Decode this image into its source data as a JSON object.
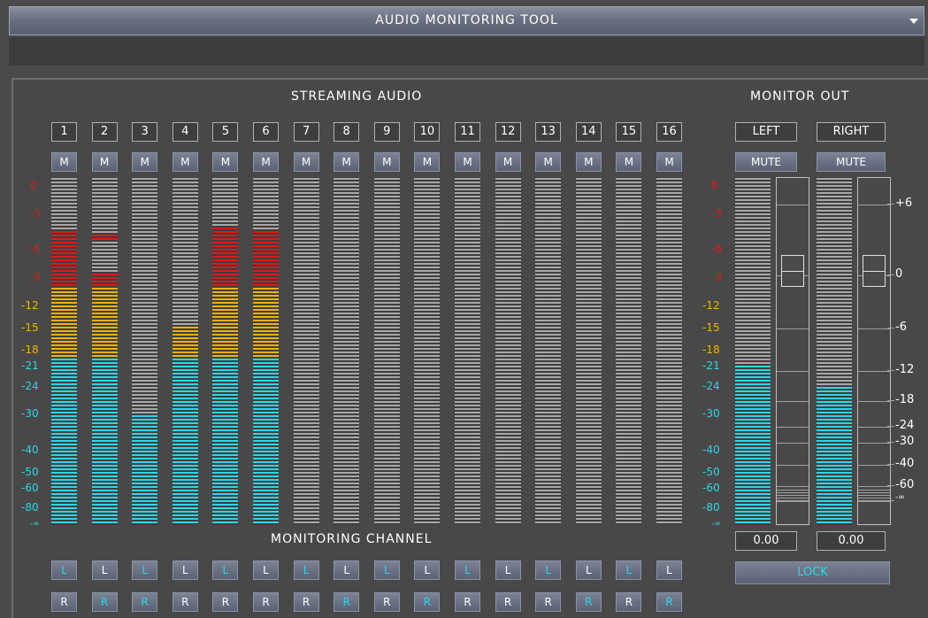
{
  "window": {
    "title": "AUDIO MONITORING TOOL"
  },
  "headings": {
    "streaming": "STREAMING AUDIO",
    "monitor_out": "MONITOR OUT",
    "monitoring_channel": "MONITORING CHANNEL"
  },
  "channels": [
    {
      "number": "1",
      "mute": "M",
      "level": -4.5,
      "peak_only": false,
      "l": "L",
      "r": "R",
      "l_on": true,
      "r_on": false
    },
    {
      "number": "2",
      "mute": "M",
      "level": -8.5,
      "peak": -5,
      "l": "L",
      "r": "R",
      "l_on": false,
      "r_on": true
    },
    {
      "number": "3",
      "mute": "M",
      "level": -30,
      "l": "L",
      "r": "R",
      "l_on": true,
      "r_on": true
    },
    {
      "number": "4",
      "mute": "M",
      "level": -15,
      "l": "L",
      "r": "R",
      "l_on": false,
      "r_on": false
    },
    {
      "number": "5",
      "mute": "M",
      "level": -4,
      "l": "L",
      "r": "R",
      "l_on": true,
      "r_on": false
    },
    {
      "number": "6",
      "mute": "M",
      "level": -4.5,
      "l": "L",
      "r": "R",
      "l_on": false,
      "r_on": false
    },
    {
      "number": "7",
      "mute": "M",
      "level": null,
      "l": "L",
      "r": "R",
      "l_on": true,
      "r_on": false
    },
    {
      "number": "8",
      "mute": "M",
      "level": null,
      "l": "L",
      "r": "R",
      "l_on": false,
      "r_on": true
    },
    {
      "number": "9",
      "mute": "M",
      "level": null,
      "l": "L",
      "r": "R",
      "l_on": true,
      "r_on": false
    },
    {
      "number": "10",
      "mute": "M",
      "level": null,
      "l": "L",
      "r": "R",
      "l_on": false,
      "r_on": true
    },
    {
      "number": "11",
      "mute": "M",
      "level": null,
      "l": "L",
      "r": "R",
      "l_on": true,
      "r_on": false
    },
    {
      "number": "12",
      "mute": "M",
      "level": null,
      "l": "L",
      "r": "R",
      "l_on": false,
      "r_on": false
    },
    {
      "number": "13",
      "mute": "M",
      "level": null,
      "l": "L",
      "r": "R",
      "l_on": true,
      "r_on": false
    },
    {
      "number": "14",
      "mute": "M",
      "level": null,
      "l": "L",
      "r": "R",
      "l_on": false,
      "r_on": true
    },
    {
      "number": "15",
      "mute": "M",
      "level": null,
      "l": "L",
      "r": "R",
      "l_on": true,
      "r_on": false
    },
    {
      "number": "16",
      "mute": "M",
      "level": null,
      "l": "L",
      "r": "R",
      "l_on": false,
      "r_on": true
    }
  ],
  "meter_scale": {
    "labels": [
      "0",
      "-3",
      "-6",
      "-9",
      "-12",
      "-15",
      "-18",
      "-21",
      "-24",
      "-30",
      "-40",
      "-50",
      "-60",
      "-80",
      "-∞"
    ],
    "colors": {
      "red": "#e01818",
      "amber": "#f0b400",
      "cyan": "#2ad8ea",
      "off": "#a8a8a8"
    }
  },
  "monitor_out": {
    "left": {
      "label": "LEFT",
      "mute": "MUTE",
      "level": -21,
      "fader_db": 0,
      "readout": "0.00"
    },
    "right": {
      "label": "RIGHT",
      "mute": "MUTE",
      "level": -24,
      "fader_db": 0,
      "readout": "0.00"
    },
    "fader_scale": [
      "+6",
      "0",
      "-6",
      "-12",
      "-18",
      "-24",
      "-30",
      "-40",
      "-60",
      "-∞"
    ],
    "lock_label": "LOCK"
  }
}
